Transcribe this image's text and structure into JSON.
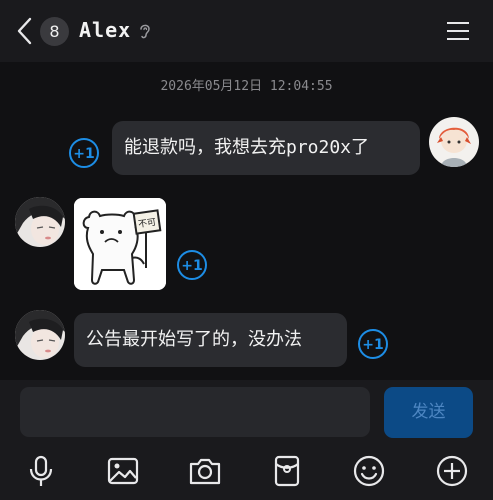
{
  "header": {
    "unread_count": "8",
    "title": "Alex",
    "icons": [
      "back-icon",
      "ear-icon",
      "menu-icon"
    ]
  },
  "chat": {
    "timestamp": "2026年05月12日  12:04:55",
    "messages": [
      {
        "side": "right",
        "type": "text",
        "text": "能退款吗，我想去充pro20x了",
        "reaction": "+1"
      },
      {
        "side": "left",
        "type": "sticker",
        "sticker_text": "不可",
        "reaction": "+1"
      },
      {
        "side": "left",
        "type": "text",
        "text": "公告最开始写了的，没办法",
        "reaction": "+1"
      }
    ]
  },
  "composer": {
    "input_value": "",
    "send_label": "发送"
  },
  "toolbar": {
    "icons": [
      "microphone-icon",
      "image-icon",
      "camera-icon",
      "red-packet-icon",
      "emoji-icon",
      "plus-icon"
    ]
  },
  "colors": {
    "background": "#111113",
    "bar": "#1a1a1d",
    "bubble": "#2b2c30",
    "accent": "#1d8de5",
    "send_button": "#0c4a86"
  }
}
